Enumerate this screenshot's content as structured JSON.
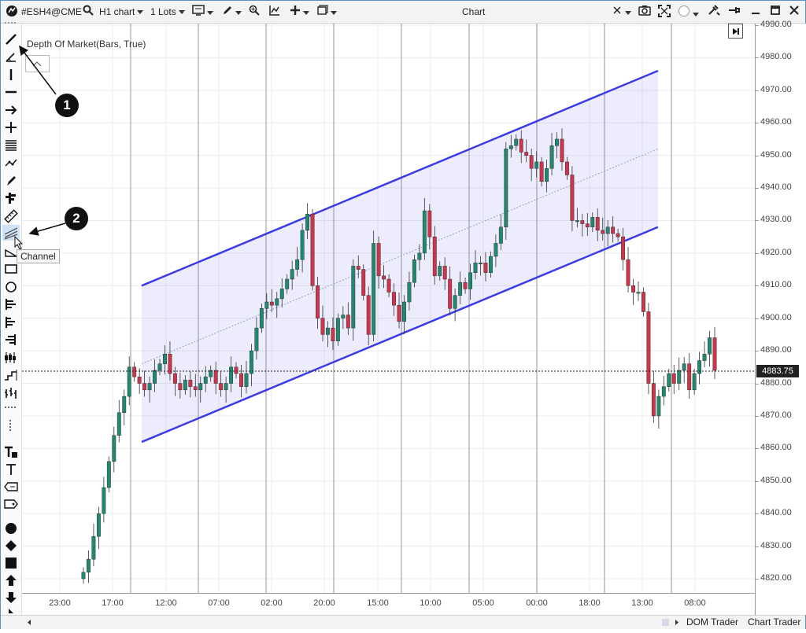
{
  "titlebar": {
    "symbol": "#ESH4@CME",
    "chart_type": "H1 chart",
    "lots": "1 Lots",
    "window_title": "Chart"
  },
  "chart": {
    "indicator_label": "Depth Of Market(Bars, True)",
    "last_price": "4883.75",
    "tooltip": "Channel",
    "price_labels": [
      "4990.00",
      "4980.00",
      "4970.00",
      "4960.00",
      "4950.00",
      "4940.00",
      "4930.00",
      "4920.00",
      "4910.00",
      "4900.00",
      "4890.00",
      "4880.00",
      "4870.00",
      "4860.00",
      "4850.00",
      "4840.00",
      "4830.00",
      "4820.00"
    ],
    "time_labels": [
      "23:00",
      "17:00",
      "12:00",
      "07:00",
      "02:00",
      "20:00",
      "15:00",
      "10:00",
      "05:00",
      "00:00",
      "18:00",
      "13:00",
      "08:00"
    ],
    "callouts": [
      "1",
      "2"
    ]
  },
  "status": {
    "dom_trader": "DOM Trader",
    "chart_trader": "Chart Trader"
  },
  "chart_data": {
    "type": "candlestick",
    "title": "",
    "ylim": [
      4815,
      4992
    ],
    "grid": true,
    "y": [
      4822,
      4826,
      4833,
      4840,
      4848,
      4856,
      4864,
      4871,
      4876,
      4885,
      4882,
      4880,
      4878,
      4880,
      4884,
      4886,
      4889,
      4883,
      4880,
      4878,
      4881,
      4879,
      4878,
      4880,
      4882,
      4884,
      4880,
      4878,
      4880,
      4885,
      4883,
      4879,
      4883,
      4890,
      4897,
      4903,
      4905,
      4904,
      4906,
      4909,
      4912,
      4915,
      4918,
      4927,
      4932,
      4910,
      4900,
      4895,
      4897,
      4893,
      4900,
      4901,
      4897,
      4916,
      4915,
      4907,
      4895,
      4923,
      4913,
      4912,
      4908,
      4904,
      4899,
      4905,
      4911,
      4918,
      4920,
      4933,
      4925,
      4913,
      4916,
      4912,
      4903,
      4907,
      4911,
      4909,
      4914,
      4917,
      4917,
      4914,
      4919,
      4923,
      4928,
      4952,
      4953,
      4955,
      4951,
      4950,
      4946,
      4948,
      4942,
      4946,
      4953,
      4955,
      4948,
      4944,
      4930,
      4930,
      4929,
      4928,
      4931,
      4927,
      4926,
      4928,
      4926,
      4925,
      4918,
      4910,
      4908,
      4908,
      4902,
      4880,
      4870,
      4876,
      4879,
      4883,
      4880,
      4884,
      4886,
      4878,
      4883,
      4887,
      4889,
      4894,
      4884
    ]
  }
}
